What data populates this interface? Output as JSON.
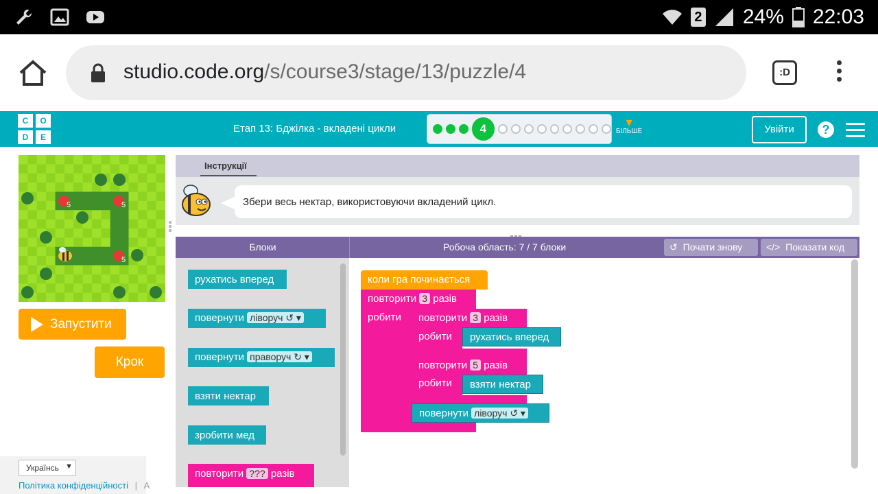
{
  "status_bar": {
    "battery": "24%",
    "time": "22:03",
    "sim": "2"
  },
  "browser": {
    "url_host": "studio.code.org",
    "url_path": "/s/course3/stage/13/puzzle/4",
    "tabs_label": ":D"
  },
  "header": {
    "logo_letters": [
      "C",
      "O",
      "D",
      "E"
    ],
    "stage_title": "Етап 13: Бджілка - вкладені цикли",
    "current_puzzle": "4",
    "more_label": "БІЛЬШЕ",
    "signin_label": "Увійти",
    "help_label": "?"
  },
  "maze": {
    "flower_counts": [
      "5",
      "5",
      "5"
    ]
  },
  "controls": {
    "run_label": "Запустити",
    "step_label": "Крок"
  },
  "footer": {
    "language": "Українсь",
    "privacy_link": "Політика конфіденційності",
    "more_link": "А"
  },
  "instructions": {
    "tab_label": "Інструкції",
    "text": "Збери весь нектар, використовуючи вкладений цикл."
  },
  "workspace_header": {
    "blocks_label": "Блоки",
    "workspace_label": "Робоча область: 7 / 7 блоки",
    "reset_label": "Почати знову",
    "show_code_label": "Показати код"
  },
  "toolbox": {
    "move_forward": "рухатись вперед",
    "turn_label": "повернути",
    "left": "ліворуч ↺",
    "right": "праворуч ↻",
    "get_nectar": "взяти нектар",
    "make_honey": "зробити мед",
    "repeat_label": "повторити",
    "repeat_value": "???",
    "times_label": "разів"
  },
  "program": {
    "when_run": "коли гра починається",
    "repeat_label": "повторити",
    "times_label": "разів",
    "do_label": "робити",
    "outer_count": "3",
    "inner1_count": "3",
    "inner2_count": "5",
    "move_forward": "рухатись вперед",
    "get_nectar": "взяти нектар",
    "turn_label": "повернути",
    "left": "ліворуч ↺"
  }
}
